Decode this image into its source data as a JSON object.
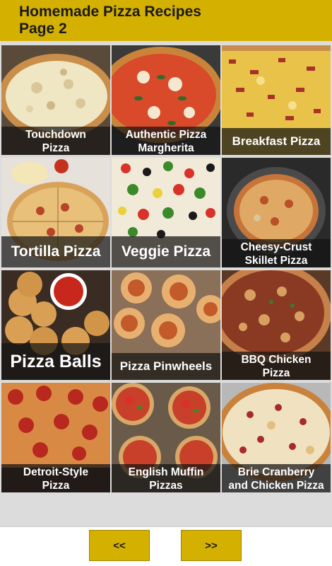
{
  "header": {
    "title_line1": "Homemade Pizza Recipes",
    "title_line2": "Page 2",
    "color": "#d4b000"
  },
  "recipes": [
    {
      "line1": "Touchdown",
      "line2": "Pizza"
    },
    {
      "line1": "Authentic Pizza",
      "line2": "Margherita"
    },
    {
      "line1": "Breakfast Pizza"
    },
    {
      "line1": "Tortilla Pizza"
    },
    {
      "line1": "Veggie Pizza"
    },
    {
      "line1": "Cheesy-Crust",
      "line2": "Skillet Pizza"
    },
    {
      "line1": "Pizza Balls"
    },
    {
      "line1": "Pizza Pinwheels"
    },
    {
      "line1": "BBQ Chicken",
      "line2": "Pizza"
    },
    {
      "line1": "Detroit-Style",
      "line2": "Pizza"
    },
    {
      "line1": "English Muffin",
      "line2": "Pizzas"
    },
    {
      "line1": "Brie Cranberry",
      "line2": "and Chicken Pizza"
    }
  ],
  "footer": {
    "prev_label": "<<",
    "next_label": ">>"
  }
}
